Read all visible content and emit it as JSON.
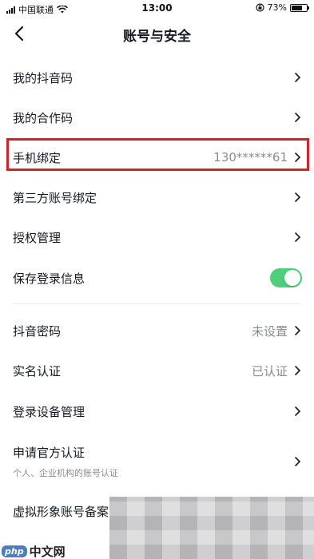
{
  "status_bar": {
    "carrier": "中国联通",
    "time": "13:00",
    "battery_percent": "73%",
    "battery_level": 0.73
  },
  "header": {
    "title": "账号与安全"
  },
  "settings": {
    "my_douyin_code": "我的抖音码",
    "my_collab_code": "我的合作码",
    "phone_binding": {
      "label": "手机绑定",
      "value": "130******61"
    },
    "third_party_binding": "第三方账号绑定",
    "authorization": "授权管理",
    "save_login_info": {
      "label": "保存登录信息",
      "enabled": true
    },
    "douyin_password": {
      "label": "抖音密码",
      "value": "未设置"
    },
    "real_name": {
      "label": "实名认证",
      "value": "已认证"
    },
    "device_management": "登录设备管理",
    "official_verification": {
      "label": "申请官方认证",
      "subtitle": "个人、企业机构的账号认证"
    },
    "virtual_avatar": "虚拟形象账号备案"
  },
  "watermark": {
    "brand": "php",
    "text": "中文网"
  },
  "colors": {
    "toggle_on": "#4cd07a",
    "highlight": "#e21c24"
  }
}
